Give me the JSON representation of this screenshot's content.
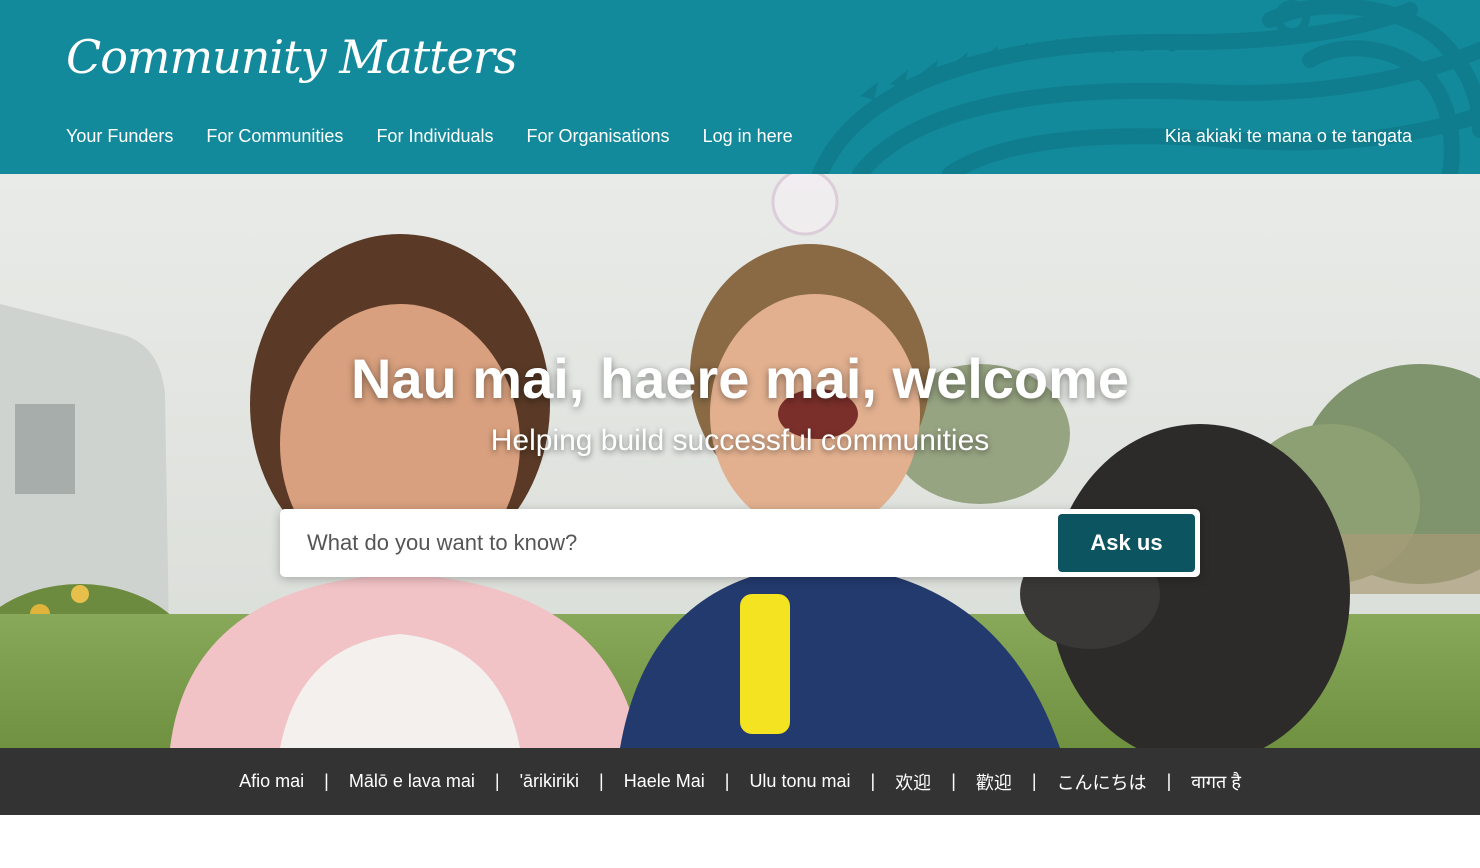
{
  "header": {
    "logo": "Community Matters",
    "tagline": "Kia akiaki te mana o te tangata",
    "nav": [
      {
        "label": "Your Funders"
      },
      {
        "label": "For Communities"
      },
      {
        "label": "For Individuals"
      },
      {
        "label": "For Organisations"
      },
      {
        "label": "Log in here"
      }
    ]
  },
  "hero": {
    "title": "Nau mai, haere mai, welcome",
    "subtitle": "Helping build successful communities",
    "search": {
      "placeholder": "What do you want to know?",
      "button_label": "Ask us"
    }
  },
  "languages": [
    "Afio mai",
    "Mālō e lava mai",
    "'ārikiriki",
    "Haele Mai",
    "Ulu tonu mai",
    "欢迎",
    "歡迎",
    "こんにちは",
    "वागत है"
  ],
  "colors": {
    "header_bg": "#138a9b",
    "ask_button": "#0d5461",
    "footer_bar": "#333333"
  }
}
